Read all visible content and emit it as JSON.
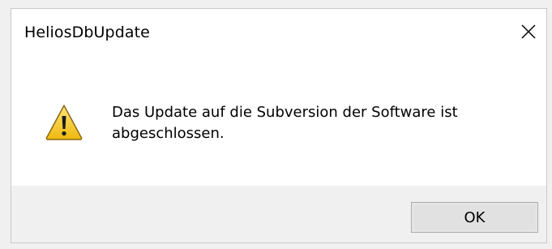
{
  "window": {
    "title": "HeliosDbUpdate"
  },
  "icons": {
    "close": "close-icon",
    "message": "warning-icon"
  },
  "message": {
    "text": "Das Update auf die Subversion der Software ist abgeschlossen."
  },
  "buttons": {
    "ok_label": "OK"
  },
  "colors": {
    "warning_fill": "#f3c221",
    "warning_border": "#7a5a00",
    "footer_bg": "#f0f0f0",
    "button_bg": "#e1e1e1",
    "button_border": "#adadad"
  }
}
